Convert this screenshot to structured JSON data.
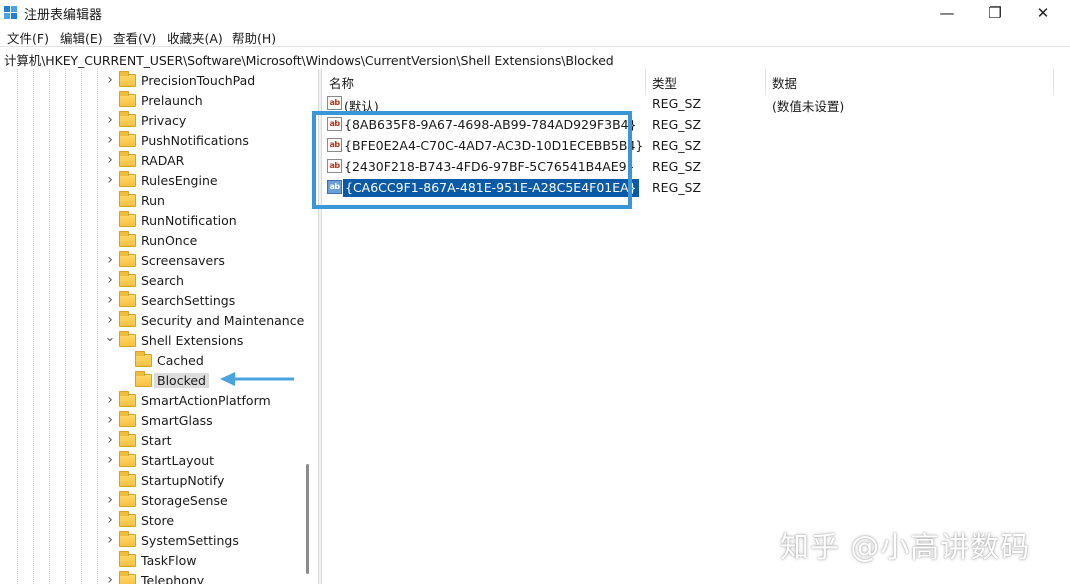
{
  "window": {
    "title": "注册表编辑器",
    "minimize_glyph": "—",
    "maximize_glyph": "❐",
    "close_glyph": "✕"
  },
  "menu": [
    "文件(F)",
    "编辑(E)",
    "查看(V)",
    "收藏夹(A)",
    "帮助(H)"
  ],
  "address": "计算机\\HKEY_CURRENT_USER\\Software\\Microsoft\\Windows\\CurrentVersion\\Shell Extensions\\Blocked",
  "tree": [
    {
      "label": "PrecisionTouchPad",
      "expander": "collapsed",
      "depth": 0
    },
    {
      "label": "Prelaunch",
      "expander": "none",
      "depth": 0
    },
    {
      "label": "Privacy",
      "expander": "collapsed",
      "depth": 0
    },
    {
      "label": "PushNotifications",
      "expander": "collapsed",
      "depth": 0
    },
    {
      "label": "RADAR",
      "expander": "collapsed",
      "depth": 0
    },
    {
      "label": "RulesEngine",
      "expander": "collapsed",
      "depth": 0
    },
    {
      "label": "Run",
      "expander": "none",
      "depth": 0
    },
    {
      "label": "RunNotification",
      "expander": "none",
      "depth": 0
    },
    {
      "label": "RunOnce",
      "expander": "none",
      "depth": 0
    },
    {
      "label": "Screensavers",
      "expander": "collapsed",
      "depth": 0
    },
    {
      "label": "Search",
      "expander": "collapsed",
      "depth": 0
    },
    {
      "label": "SearchSettings",
      "expander": "collapsed",
      "depth": 0
    },
    {
      "label": "Security and Maintenance",
      "expander": "collapsed",
      "depth": 0
    },
    {
      "label": "Shell Extensions",
      "expander": "expanded",
      "depth": 0
    },
    {
      "label": "Cached",
      "expander": "none",
      "depth": 1
    },
    {
      "label": "Blocked",
      "expander": "none",
      "depth": 1,
      "selected": true
    },
    {
      "label": "SmartActionPlatform",
      "expander": "collapsed",
      "depth": 0
    },
    {
      "label": "SmartGlass",
      "expander": "collapsed",
      "depth": 0
    },
    {
      "label": "Start",
      "expander": "collapsed",
      "depth": 0
    },
    {
      "label": "StartLayout",
      "expander": "collapsed",
      "depth": 0
    },
    {
      "label": "StartupNotify",
      "expander": "none",
      "depth": 0
    },
    {
      "label": "StorageSense",
      "expander": "collapsed",
      "depth": 0
    },
    {
      "label": "Store",
      "expander": "collapsed",
      "depth": 0
    },
    {
      "label": "SystemSettings",
      "expander": "collapsed",
      "depth": 0
    },
    {
      "label": "TaskFlow",
      "expander": "none",
      "depth": 0
    },
    {
      "label": "Telephony",
      "expander": "collapsed",
      "depth": 0
    }
  ],
  "list": {
    "columns": {
      "name": "名称",
      "type": "类型",
      "data": "数据"
    },
    "rows": [
      {
        "icon": "ab",
        "name": "(默认)",
        "type": "REG_SZ",
        "data": "(数值未设置)"
      },
      {
        "icon": "ab",
        "name": "{8AB635F8-9A67-4698-AB99-784AD929F3B4}",
        "type": "REG_SZ",
        "data": ""
      },
      {
        "icon": "ab",
        "name": "{BFE0E2A4-C70C-4AD7-AC3D-10D1ECEBB5B4}",
        "type": "REG_SZ",
        "data": ""
      },
      {
        "icon": "ab",
        "name": "{2430F218-B743-4FD6-97BF-5C76541B4AE9}",
        "type": "REG_SZ",
        "data": ""
      },
      {
        "icon": "ab",
        "name": "{CA6CC9F1-867A-481E-951E-A28C5E4F01EA}",
        "type": "REG_SZ",
        "data": "",
        "selected": true
      }
    ]
  },
  "annotation_color": "#3a96d8",
  "watermark": "知乎 @小高讲数码"
}
